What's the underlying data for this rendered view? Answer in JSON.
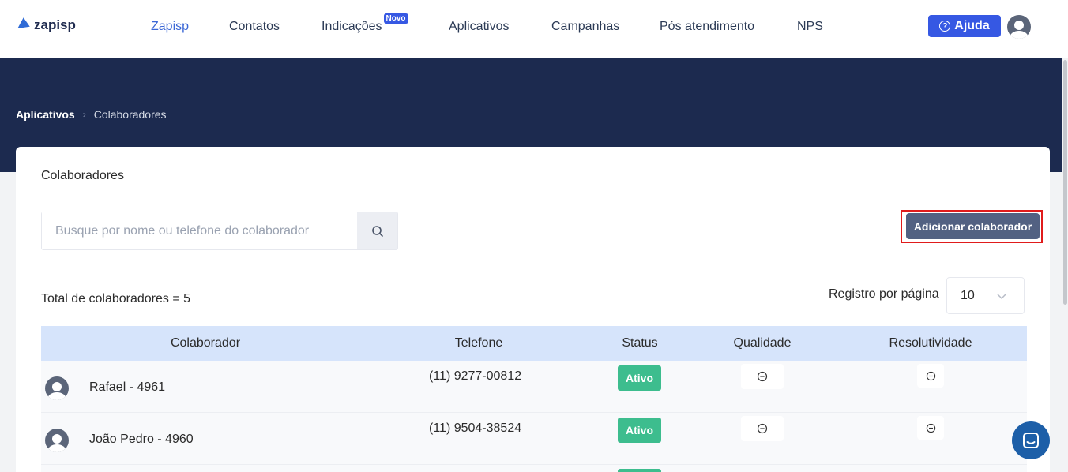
{
  "header": {
    "logo_text": "zapisp",
    "nav": [
      {
        "label": "Zapisp",
        "active": true
      },
      {
        "label": "Contatos"
      },
      {
        "label": "Indicações",
        "badge": "Novo"
      },
      {
        "label": "Aplicativos"
      },
      {
        "label": "Campanhas"
      },
      {
        "label": "Pós atendimento"
      },
      {
        "label": "NPS"
      }
    ],
    "help_label": "Ajuda"
  },
  "breadcrumb": [
    "Aplicativos",
    "Colaboradores"
  ],
  "card": {
    "title": "Colaboradores",
    "search": {
      "placeholder": "Busque por nome ou telefone do colaborador",
      "value": ""
    },
    "add_button": "Adicionar colaborador",
    "total_label": "Total de colaboradores = 5",
    "per_page": {
      "label": "Registro por página",
      "value": "10"
    }
  },
  "table": {
    "headers": [
      "Colaborador",
      "Telefone",
      "Status",
      "Qualidade",
      "Resolutividade"
    ],
    "rows": [
      {
        "name": "Rafael - 4961",
        "phone": "(11) 9277-00812",
        "status": "Ativo"
      },
      {
        "name": "João Pedro - 4960",
        "phone": "(11) 9504-38524",
        "status": "Ativo"
      }
    ]
  },
  "icons": {
    "search": "search-icon",
    "chevron": "chevron-down-icon",
    "quality": "minus-circle-icon",
    "resol": "minus-circle-icon",
    "chat": "chat-icon",
    "help": "question-circle-icon"
  },
  "colors": {
    "accent": "#3658e3",
    "hero": "#1c2a4f",
    "status_active": "#3dbd8e",
    "primary_button": "#526182"
  }
}
